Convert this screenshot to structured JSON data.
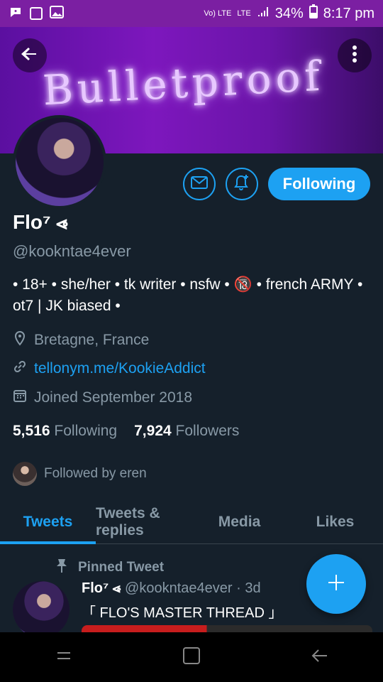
{
  "status_bar": {
    "left_icons": [
      "chat-icon",
      "checkbox-icon",
      "image-icon"
    ],
    "network": "Vo) LTE",
    "lte": "LTE",
    "battery": "34%",
    "time": "8:17 pm"
  },
  "header": {
    "banner_text": "Bulletproof"
  },
  "profile": {
    "name": "Flo⁷ ⩹",
    "handle": "@kookntae4ever",
    "bio": "• 18+ • she/her • tk writer • nsfw • 🔞 • french ARMY • ot7 | JK biased •",
    "location": "Bretagne, France",
    "link": "tellonym.me/KookieAddict",
    "joined": "Joined September 2018",
    "following_count": "5,516",
    "following_label": "Following",
    "followers_count": "7,924",
    "followers_label": "Followers",
    "followed_by": "Followed by eren",
    "follow_button_label": "Following"
  },
  "tabs": [
    {
      "label": "Tweets"
    },
    {
      "label": "Tweets & replies"
    },
    {
      "label": "Media"
    },
    {
      "label": "Likes"
    }
  ],
  "pinned_tweet": {
    "pinned_label": "Pinned Tweet",
    "author": "Flo⁷ ⩹",
    "handle_time": "@kookntae4ever · 3d",
    "text": "「 FLO'S MASTER THREAD 」"
  },
  "colors": {
    "accent": "#1da1f2",
    "background": "#15202b",
    "muted": "#8899a6",
    "status_bar": "#7b1fa2"
  }
}
